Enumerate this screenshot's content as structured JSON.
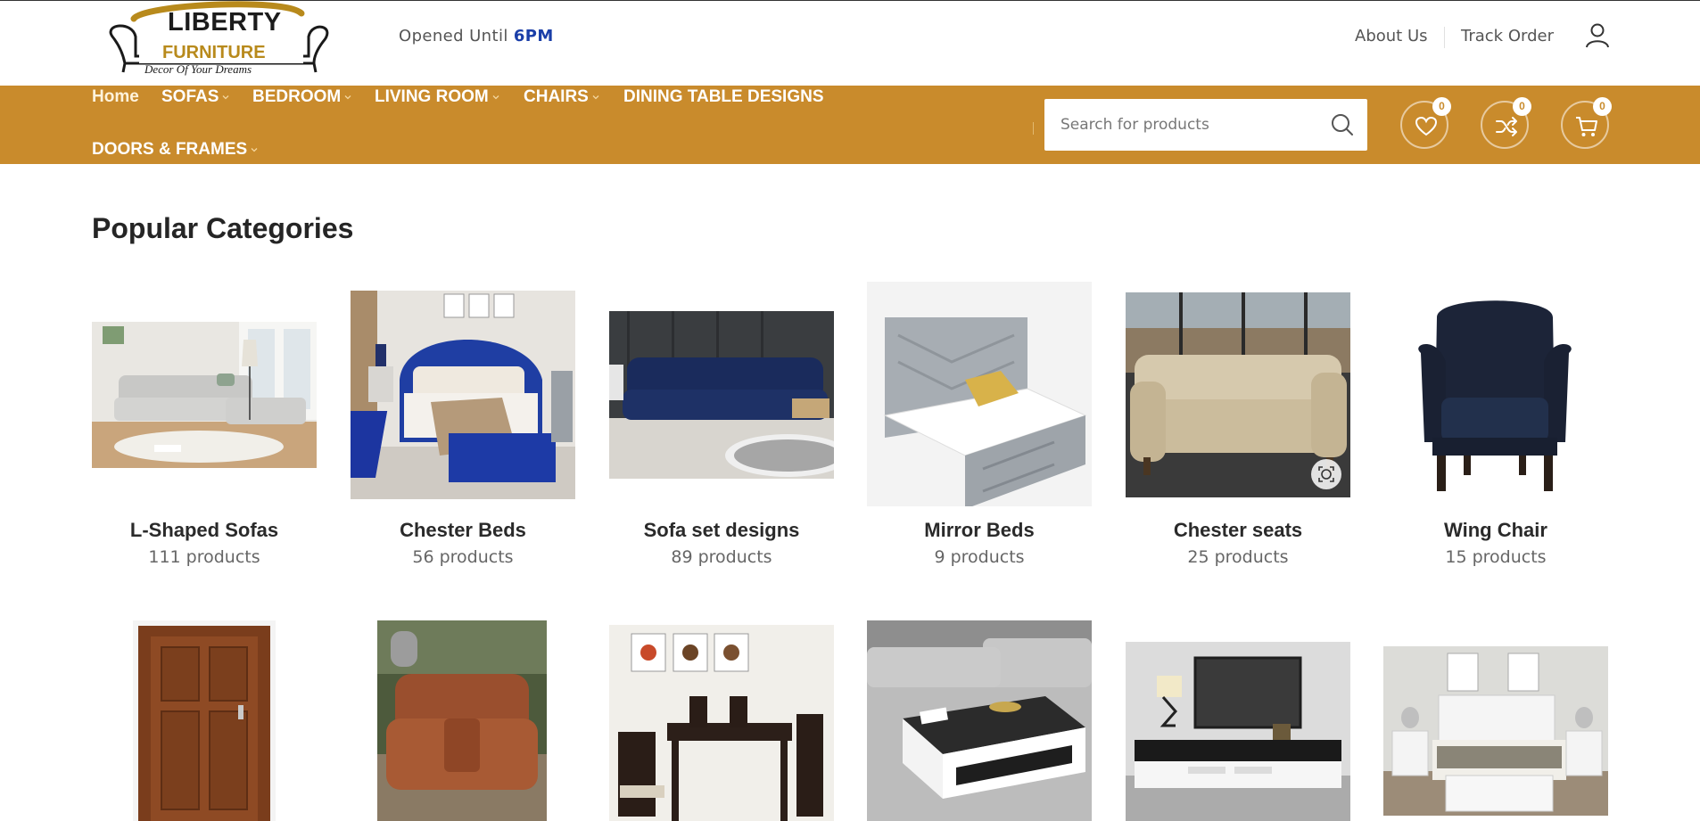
{
  "header": {
    "logo": {
      "brand": "LIBERTY",
      "sub": "FURNITURE",
      "tagline": "Decor Of Your Dreams"
    },
    "hours_prefix": "Opened Until ",
    "hours_time": "6PM",
    "links": [
      "About Us",
      "Track Order"
    ],
    "user_icon": "user-icon"
  },
  "nav": {
    "items": [
      {
        "label": "Home",
        "dropdown": false
      },
      {
        "label": "SOFAS",
        "dropdown": true
      },
      {
        "label": "BEDROOM",
        "dropdown": true
      },
      {
        "label": "LIVING ROOM",
        "dropdown": true
      },
      {
        "label": "CHAIRS",
        "dropdown": true
      },
      {
        "label": "DINING TABLE DESIGNS",
        "dropdown": false
      },
      {
        "label": "DOORS & FRAMES",
        "dropdown": true
      }
    ],
    "search_placeholder": "Search for products",
    "wishlist_count": "0",
    "compare_count": "0",
    "cart_count": "0"
  },
  "main": {
    "title": "Popular Categories",
    "categories": [
      {
        "name": "L-Shaped Sofas",
        "count": "111 products",
        "icon": "l-shaped-sofa-image"
      },
      {
        "name": "Chester Beds",
        "count": "56 products",
        "icon": "blue-tufted-bed-image"
      },
      {
        "name": "Sofa set designs",
        "count": "89 products",
        "icon": "navy-sofa-image"
      },
      {
        "name": "Mirror Beds",
        "count": "9 products",
        "icon": "grey-bed-image"
      },
      {
        "name": "Chester seats",
        "count": "25 products",
        "icon": "beige-chesterfield-image"
      },
      {
        "name": "Wing Chair",
        "count": "15 products",
        "icon": "navy-wing-chair-image"
      }
    ],
    "second_row": [
      {
        "icon": "wooden-door-image"
      },
      {
        "icon": "leather-recliner-image"
      },
      {
        "icon": "dining-set-image"
      },
      {
        "icon": "coffee-table-image"
      },
      {
        "icon": "tv-stand-image"
      },
      {
        "icon": "white-bed-image"
      }
    ]
  },
  "colors": {
    "accent": "#c98b2c",
    "brand_blue": "#1a3ea8",
    "logo_gold": "#b88a1c"
  }
}
